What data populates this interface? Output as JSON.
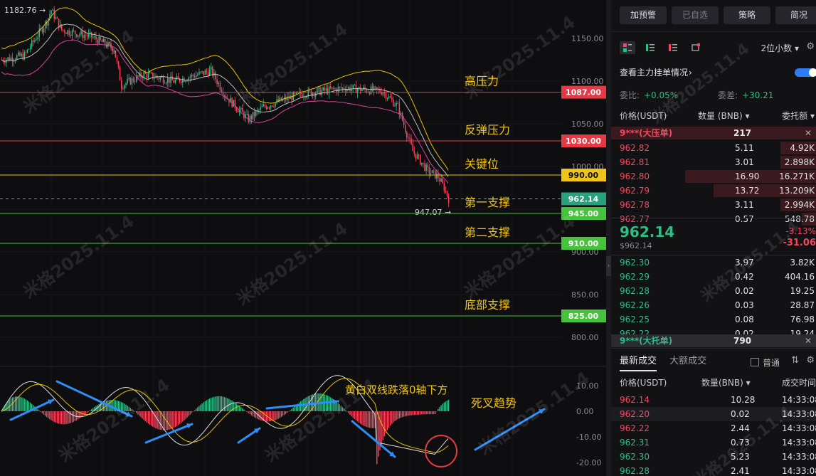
{
  "chart": {
    "high_label": "1182.76",
    "low_label": "947.07",
    "price_ticks": [
      "1150.00",
      "1100.00",
      "1050.00",
      "1000.00",
      "900.00",
      "850.00",
      "800.00"
    ],
    "macd_ticks": [
      "10.00",
      "0.00",
      "-10.00",
      "-20.00"
    ],
    "levels": [
      {
        "price": "1087.00",
        "label": "高压力",
        "color": "#e53945",
        "tag_bg": "#e53945"
      },
      {
        "price": "1030.00",
        "label": "反弹压力",
        "color": "#e53945",
        "tag_bg": "#e53945"
      },
      {
        "price": "990.00",
        "label": "关键位",
        "color": "#e6c200",
        "tag_bg": "#f0c419"
      },
      {
        "price": "962.14",
        "label": "",
        "color": "#2ebd85",
        "tag_bg": "#26a17b"
      },
      {
        "price": "945.00",
        "label": "第一支撑",
        "color": "#47c23d",
        "tag_bg": "#47c23d"
      },
      {
        "price": "910.00",
        "label": "第二支撑",
        "color": "#47c23d",
        "tag_bg": "#47c23d"
      },
      {
        "price": "825.00",
        "label": "底部支撑",
        "color": "#47c23d",
        "tag_bg": "#47c23d"
      }
    ],
    "annotations": {
      "macd_note": "黄白双线跌落0轴下方",
      "death_cross": "死叉趋势"
    },
    "watermark": "米格2025.11.4"
  },
  "side": {
    "buttons": [
      "加预警",
      "已自选",
      "策略",
      "简况"
    ],
    "precision": "2位小数",
    "main_orders_title": "查看主力挂单情况",
    "ratio_label": "委比:",
    "ratio_value": "+0.05%",
    "diff_label": "委差:",
    "diff_value": "+30.21",
    "headers": {
      "price": "价格(USDT)",
      "qty": "数量 (BNB)",
      "total": "委托额"
    },
    "big_ask": {
      "name": "9***(大压单)",
      "qty": "217"
    },
    "asks": [
      {
        "price": "962.82",
        "qty": "5.11",
        "total": "4.92K",
        "depth": 0.25
      },
      {
        "price": "962.81",
        "qty": "3.01",
        "total": "2.898K",
        "depth": 0.25
      },
      {
        "price": "962.80",
        "qty": "16.90",
        "total": "16.271K",
        "depth": 0.92
      },
      {
        "price": "962.79",
        "qty": "13.72",
        "total": "13.209K",
        "depth": 0.72
      },
      {
        "price": "962.78",
        "qty": "3.11",
        "total": "2.994K",
        "depth": 0.25
      },
      {
        "price": "962.77",
        "qty": "0.57",
        "total": "548.78",
        "depth": 0.1
      }
    ],
    "last_price": "962.14",
    "last_price_usd": "$962.14",
    "change_pct": "-3.13%",
    "change_abs": "-31.06",
    "bids": [
      {
        "price": "962.30",
        "qty": "3.97",
        "total": "3.82K"
      },
      {
        "price": "962.29",
        "qty": "0.42",
        "total": "404.16"
      },
      {
        "price": "962.28",
        "qty": "0.02",
        "total": "19.25"
      },
      {
        "price": "962.26",
        "qty": "0.03",
        "total": "28.87"
      },
      {
        "price": "962.25",
        "qty": "0.08",
        "total": "76.98"
      },
      {
        "price": "962.22",
        "qty": "0.02",
        "total": "19.24"
      }
    ],
    "big_bid": {
      "name": "9***(大托单)",
      "qty": "790"
    },
    "trades_tab": "最新成交",
    "big_trades_tab": "大额成交",
    "normal_label": "普通",
    "trade_headers": {
      "price": "价格(USDT)",
      "qty": "数量(BNB)",
      "time": "成交时间"
    },
    "trades": [
      {
        "price": "962.14",
        "qty": "10.28",
        "time": "14:33:08",
        "side": "sell"
      },
      {
        "price": "962.20",
        "qty": "0.02",
        "time": "14:33:08",
        "side": "sell"
      },
      {
        "price": "962.22",
        "qty": "2.44",
        "time": "14:33:08",
        "side": "sell"
      },
      {
        "price": "962.31",
        "qty": "0.73",
        "time": "14:33:08",
        "side": "buy"
      },
      {
        "price": "962.30",
        "qty": "5.23",
        "time": "14:33:08",
        "side": "buy"
      },
      {
        "price": "962.28",
        "qty": "2.41",
        "time": "14:33:08",
        "side": "buy"
      }
    ]
  }
}
